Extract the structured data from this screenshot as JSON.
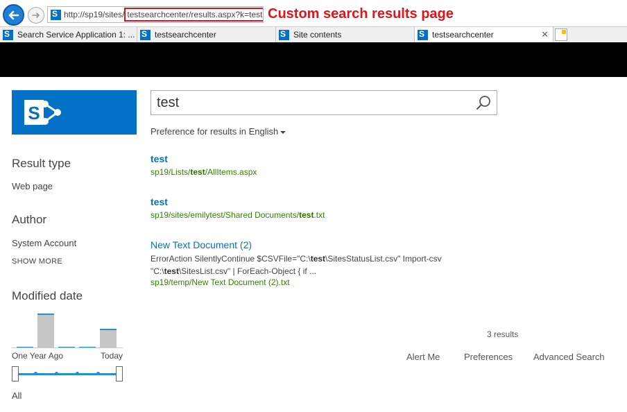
{
  "browser": {
    "url_prefix": "http://sp19/sites/",
    "url_highlight": "testsearchcenter/results.aspx?k=test",
    "annotation": "Custom search results page",
    "tabs": [
      {
        "label": "Search Service Application 1: ...",
        "active": false
      },
      {
        "label": "testsearchcenter",
        "active": false
      },
      {
        "label": "Site contents",
        "active": false
      },
      {
        "label": "testsearchcenter",
        "active": true
      }
    ],
    "close_glyph": "✕"
  },
  "search": {
    "query": "test",
    "preference_prefix": "Preference for results in",
    "preference_language": "English"
  },
  "refiners": {
    "result_type": {
      "title": "Result type",
      "items": [
        "Web page"
      ]
    },
    "author": {
      "title": "Author",
      "items": [
        "System Account"
      ],
      "show_more": "SHOW MORE"
    },
    "modified_date": {
      "title": "Modified date",
      "histogram": [
        0.03,
        0.9,
        0.03,
        0.03,
        0.5
      ],
      "start_label": "One Year Ago",
      "end_label": "Today",
      "range_label": "All"
    }
  },
  "results": [
    {
      "title": "test",
      "url_before": "sp19/Lists/",
      "url_bold": "test",
      "url_after": "/AllItems.aspx"
    },
    {
      "title": "test",
      "url_before": "sp19/sites/emilytest/Shared Documents/",
      "url_bold": "test",
      "url_after": ".txt"
    },
    {
      "title": "New Text Document (2)",
      "snippet_line1_before": "ErrorAction SilentlyContinue $CSVFile=\"C:\\",
      "snippet_line1_bold": "test",
      "snippet_line1_after": "\\SitesStatusList.csv\" Import-csv",
      "snippet_line2_before": "\"C:\\",
      "snippet_line2_bold": "test",
      "snippet_line2_after": "\\SitesList.csv\" | ForEach-Object { if ...",
      "url": "sp19/temp/New Text Document (2).txt"
    }
  ],
  "footer": {
    "result_count": "3 results",
    "links": [
      "Alert Me",
      "Preferences",
      "Advanced Search"
    ]
  },
  "colors": {
    "brand": "#0372c6",
    "link": "#0072c6",
    "url_green": "#338200",
    "annotation_red": "#e0141a"
  }
}
